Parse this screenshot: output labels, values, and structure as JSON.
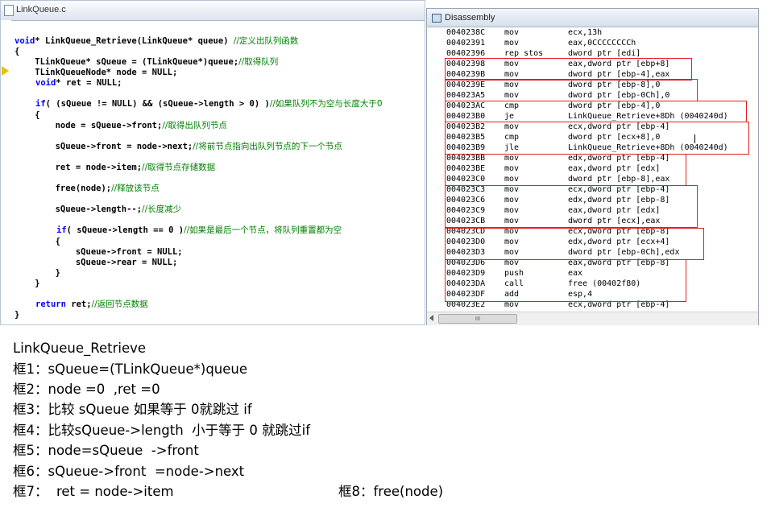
{
  "editor": {
    "tab_label": "LinkQueue.c",
    "lines": [
      {
        "k1": "void",
        "code": "* LinkQueue_Retrieve(LinkQueue* queue) ",
        "comment": "//定义出队列函数"
      },
      {
        "code": "{"
      },
      {
        "code": "    TLinkQueue* sQueue = (TLinkQueue*)queue;",
        "comment": "//取得队列"
      },
      {
        "code": "    TLinkQueueNode* node = NULL;"
      },
      {
        "k1": "void",
        "code": "* ret = NULL;"
      },
      {
        "k1": "if",
        "code": "( (sQueue != NULL) && (sQueue->length > 0) )",
        "comment": "//如果队列不为空与长度大于0"
      },
      {
        "code": "    {"
      },
      {
        "code": "        node = sQueue->front;",
        "comment": "//取得出队列节点"
      },
      {
        "code": "        sQueue->front = node->next;",
        "comment": "//将前节点指向出队列节点的下一个节点"
      },
      {
        "code": "        ret = node->item;",
        "comment": "//取得节点存储数据"
      },
      {
        "code": "        free(node);",
        "comment": "//释放该节点"
      },
      {
        "code": "        sQueue->length--;",
        "comment": "//长度减少"
      },
      {
        "k1": "if",
        "code": "( sQueue->length == 0 )",
        "comment": "//如果是最后一个节点，将队列重置都为空"
      },
      {
        "code": "        {"
      },
      {
        "code": "            sQueue->front = NULL;"
      },
      {
        "code": "            sQueue->rear = NULL;"
      },
      {
        "code": "        }"
      },
      {
        "code": "    }"
      },
      {
        "k1": "return",
        "code": " ret;",
        "comment": "//返回节点数据"
      },
      {
        "code": "}"
      }
    ]
  },
  "disassembly": {
    "title": "Disassembly",
    "scroll_thumb_label": "III",
    "rows": [
      {
        "addr": "0040238C",
        "mn": "mov",
        "op": "ecx,13h"
      },
      {
        "addr": "00402391",
        "mn": "mov",
        "op": "eax,0CCCCCCCCh"
      },
      {
        "addr": "00402396",
        "mn": "rep stos",
        "op": "dword ptr [edi]"
      },
      {
        "addr": "00402398",
        "mn": "mov",
        "op": "eax,dword ptr [ebp+8]"
      },
      {
        "addr": "0040239B",
        "mn": "mov",
        "op": "dword ptr [ebp-4],eax"
      },
      {
        "addr": "0040239E",
        "mn": "mov",
        "op": "dword ptr [ebp-8],0"
      },
      {
        "addr": "004023A5",
        "mn": "mov",
        "op": "dword ptr [ebp-0Ch],0"
      },
      {
        "addr": "004023AC",
        "mn": "cmp",
        "op": "dword ptr [ebp-4],0"
      },
      {
        "addr": "004023B0",
        "mn": "je",
        "op": "LinkQueue_Retrieve+8Dh (0040240d)"
      },
      {
        "addr": "004023B2",
        "mn": "mov",
        "op": "ecx,dword ptr [ebp-4]"
      },
      {
        "addr": "004023B5",
        "mn": "cmp",
        "op": "dword ptr [ecx+8],0"
      },
      {
        "addr": "004023B9",
        "mn": "jle",
        "op": "LinkQueue_Retrieve+8Dh (0040240d)"
      },
      {
        "addr": "004023BB",
        "mn": "mov",
        "op": "edx,dword ptr [ebp-4]"
      },
      {
        "addr": "004023BE",
        "mn": "mov",
        "op": "eax,dword ptr [edx]"
      },
      {
        "addr": "004023C0",
        "mn": "mov",
        "op": "dword ptr [ebp-8],eax"
      },
      {
        "addr": "004023C3",
        "mn": "mov",
        "op": "ecx,dword ptr [ebp-4]"
      },
      {
        "addr": "004023C6",
        "mn": "mov",
        "op": "edx,dword ptr [ebp-8]"
      },
      {
        "addr": "004023C9",
        "mn": "mov",
        "op": "eax,dword ptr [edx]"
      },
      {
        "addr": "004023CB",
        "mn": "mov",
        "op": "dword ptr [ecx],eax"
      },
      {
        "addr": "004023CD",
        "mn": "mov",
        "op": "ecx,dword ptr [ebp-8]"
      },
      {
        "addr": "004023D0",
        "mn": "mov",
        "op": "edx,dword ptr [ecx+4]"
      },
      {
        "addr": "004023D3",
        "mn": "mov",
        "op": "dword ptr [ebp-0Ch],edx"
      },
      {
        "addr": "004023D6",
        "mn": "mov",
        "op": "eax,dword ptr [ebp-8]"
      },
      {
        "addr": "004023D9",
        "mn": "push",
        "op": "eax"
      },
      {
        "addr": "004023DA",
        "mn": "call",
        "op": "free (00402f80)"
      },
      {
        "addr": "004023DF",
        "mn": "add",
        "op": "esp,4"
      },
      {
        "addr": "004023E2",
        "mn": "mov",
        "op": "ecx,dword ptr [ebp-4]"
      }
    ]
  },
  "notes": {
    "title": "LinkQueue_Retrieve",
    "box1": "框1：sQueue=(TLinkQueue*)queue",
    "box2": "框2：node =0  ,ret =0",
    "box3": "框3：比较 sQueue 如果等于 0就跳过 if",
    "box4": "框4：比较sQueue->length  小于等于 0 就跳过if",
    "box5": "框5：node=sQueue  ->front",
    "box6": "框6：sQueue->front  =node->next",
    "box7": "框7：  ret = node->item",
    "box8": "框8：free(node)"
  },
  "colors": {
    "keyword": "#0000ff",
    "comment": "#008000",
    "highlight_box": "#e02020"
  }
}
